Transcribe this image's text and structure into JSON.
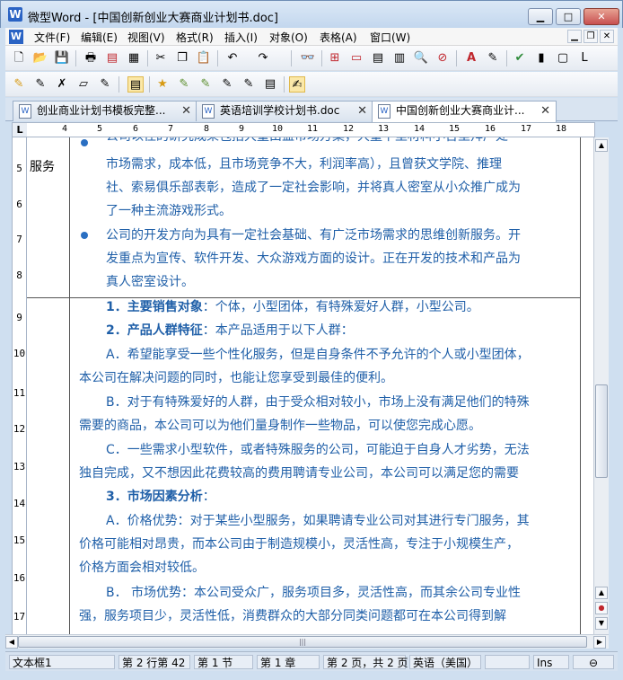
{
  "window": {
    "title": "微型Word - [中国创新创业大赛商业计划书.doc]",
    "app_icon": "word-app-icon",
    "controls": [
      "minimize-icon",
      "maximize-icon",
      "close-icon"
    ]
  },
  "menu": {
    "items": [
      "文件(F)",
      "编辑(E)",
      "视图(V)",
      "格式(R)",
      "插入(I)",
      "对象(O)",
      "表格(A)",
      "窗口(W)"
    ]
  },
  "toolbar1": {
    "icons": [
      "new-icon",
      "open-icon",
      "save-icon",
      "print-icon",
      "pdf-icon",
      "print-preview-icon",
      "cut-icon",
      "copy-icon",
      "paste-icon",
      "undo-icon",
      "redo-icon",
      "find-icon",
      "line-spacing-icon",
      "insert-field-icon",
      "table-icon",
      "columns-icon",
      "zoom-icon",
      "track-icon",
      "font-color-icon",
      "edit-icon",
      "spell-check-icon",
      "chart-icon",
      "frame-icon",
      "layout-icon"
    ]
  },
  "toolbar2": {
    "icons": [
      "star-edit-icon",
      "edit-pencil-icon",
      "delete-pencil-icon",
      "eraser-icon",
      "pencil-doc-icon",
      "active-doc-icon",
      "pen-a-icon",
      "pen-b-icon",
      "pen-c-icon",
      "pen-d-icon",
      "pen-e-icon",
      "notebook-icon",
      "sign-icon"
    ]
  },
  "tabs": [
    {
      "label": "创业商业计划书模板完整...",
      "active": false
    },
    {
      "label": "英语培训学校计划书.doc",
      "active": false
    },
    {
      "label": "中国创新创业大赛商业计...",
      "active": true
    }
  ],
  "ruler": {
    "corner": "L",
    "numbers": [
      "4",
      "5",
      "6",
      "7",
      "8",
      "9",
      "10",
      "11",
      "12",
      "13",
      "14",
      "15",
      "16",
      "17",
      "18"
    ],
    "vertical": [
      "5",
      "6",
      "7",
      "8",
      "9",
      "10",
      "11",
      "12",
      "13",
      "14",
      "15",
      "16",
      "17"
    ]
  },
  "document": {
    "cell_label": "服务",
    "cut_line": "公司以往的研究成果包括大量由益市场方案，大量下里材料小台里拜产处",
    "lines_block1": [
      "市场需求，成本低，且市场竞争不大，利润率高），且曾获文学院、推理",
      "社、索易俱乐部表彰，造成了一定社会影响，并将真人密室从小众推广成为",
      "了一种主流游戏形式。"
    ],
    "bullet2_lines": [
      "公司的开发方向为具有一定社会基础、有广泛市场需求的思维创新服务。开",
      "发重点为宣传、软件开发、大众游戏方面的设计。正在开发的技术和产品为",
      "真人密室设计。"
    ],
    "item1_bold": "1．主要销售对象",
    "item1_rest": "：个体，小型团体，有特殊爱好人群，小型公司。",
    "item2_bold": "2．产品人群特征",
    "item2_rest": "：本产品适用于以下人群：",
    "paraA": [
      "A．希望能享受一些个性化服务，但是自身条件不予允许的个人或小型团体，",
      "本公司在解决问题的同时，也能让您享受到最佳的便利。"
    ],
    "paraB": [
      "B．对于有特殊爱好的人群，由于受众相对较小，市场上没有满足他们的特殊",
      "需要的商品，本公司可以为他们量身制作一些物品，可以使您完成心愿。"
    ],
    "paraC": [
      "C．一些需求小型软件，或者特殊服务的公司，可能迫于自身人才劣势，无法",
      "独自完成，又不想因此花费较高的费用聘请专业公司，本公司可以满足您的需要"
    ],
    "item3_bold": "3．市场因素分析",
    "item3_rest": "：",
    "paraA2": [
      "A．价格优势：对于某些小型服务，如果聘请专业公司对其进行专门服务，其",
      "价格可能相对昂贵，而本公司由于制造规模小，灵活性高，专注于小规模生产，",
      "价格方面会相对较低。"
    ],
    "paraB2": [
      "B．    市场优势：本公司受众广，服务项目多，灵活性高，而其余公司专业性",
      "强，服务项目少，灵活性低，消费群众的大部分同类问题都可在本公司得到解"
    ]
  },
  "hscroll_grip": "|||",
  "status": {
    "frame": "文本框1",
    "line_col": "第 2 行第 42",
    "section": "第 1 节",
    "chapter": "第 1 章",
    "page": "第 2 页，共 2 页",
    "language": "英语（美国）",
    "mode": "Ins"
  },
  "colors": {
    "body_text": "#1f5fa8",
    "bullet": "#2a6fc2",
    "chrome": "#cfdff0"
  }
}
